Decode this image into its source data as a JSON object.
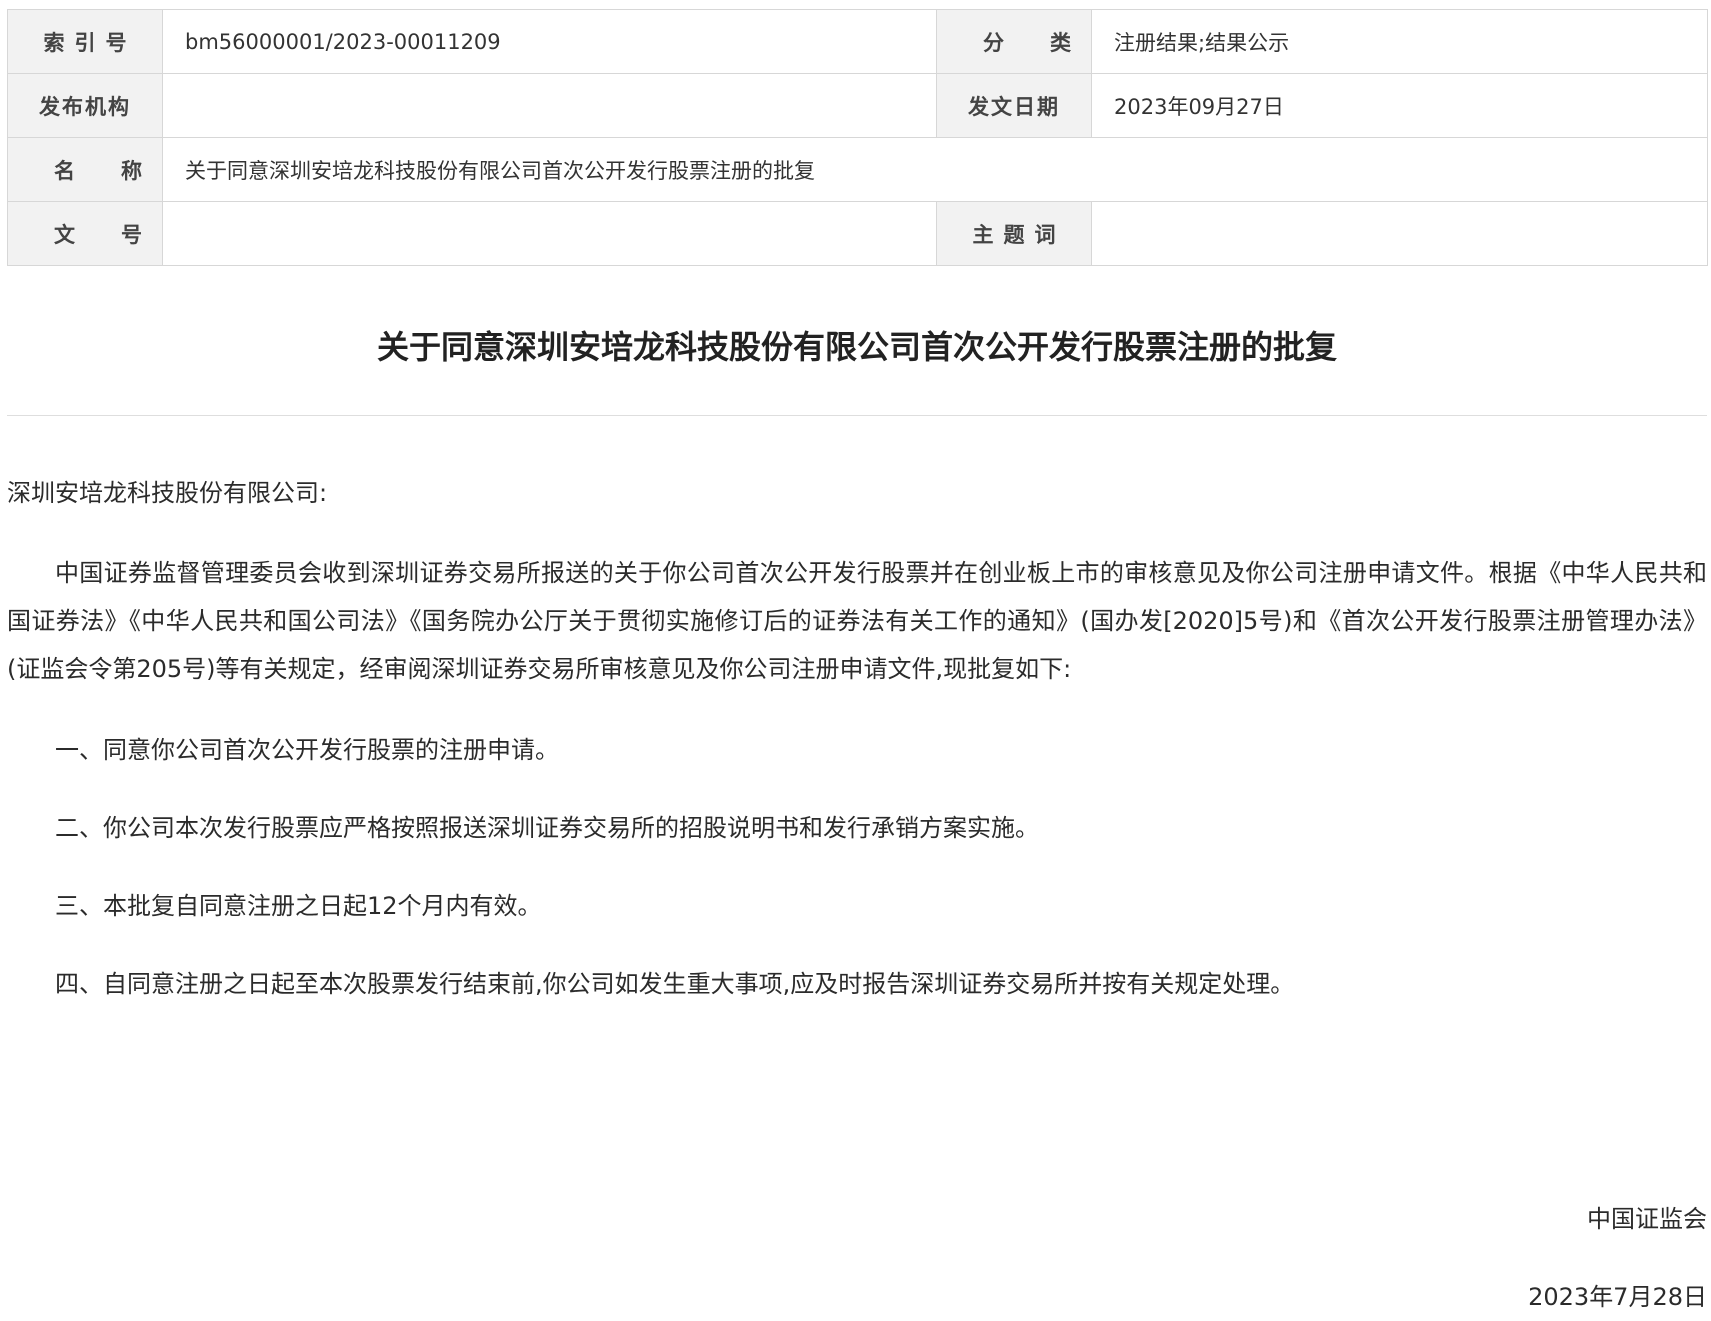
{
  "meta": {
    "index_label": "索引号",
    "index_value": "bm56000001/2023-00011209",
    "category_label": "分类",
    "category_value": "注册结果;结果公示",
    "publisher_label": "发布机构",
    "publisher_value": "",
    "date_label": "发文日期",
    "date_value": "2023年09月27日",
    "name_label": "名称",
    "name_value": "关于同意深圳安培龙科技股份有限公司首次公开发行股票注册的批复",
    "docno_label": "文号",
    "docno_value": "",
    "keyword_label": "主题词",
    "keyword_value": ""
  },
  "document": {
    "title": "关于同意深圳安培龙科技股份有限公司首次公开发行股票注册的批复",
    "salutation": "深圳安培龙科技股份有限公司:",
    "main_paragraph": "中国证券监督管理委员会收到深圳证券交易所报送的关于你公司首次公开发行股票并在创业板上市的审核意见及你公司注册申请文件。根据《中华人民共和国证券法》《中华人民共和国公司法》《国务院办公厅关于贯彻实施修订后的证券法有关工作的通知》(国办发[2020]5号)和《首次公开发行股票注册管理办法》(证监会令第205号)等有关规定，经审阅深圳证券交易所审核意见及你公司注册申请文件,现批复如下:",
    "items": [
      "一、同意你公司首次公开发行股票的注册申请。",
      "二、你公司本次发行股票应严格按照报送深圳证券交易所的招股说明书和发行承销方案实施。",
      "三、本批复自同意注册之日起12个月内有效。",
      "四、自同意注册之日起至本次股票发行结束前,你公司如发生重大事项,应及时报告深圳证券交易所并按有关规定处理。"
    ],
    "signature": "中国证监会",
    "sign_date": "2023年7月28日"
  }
}
